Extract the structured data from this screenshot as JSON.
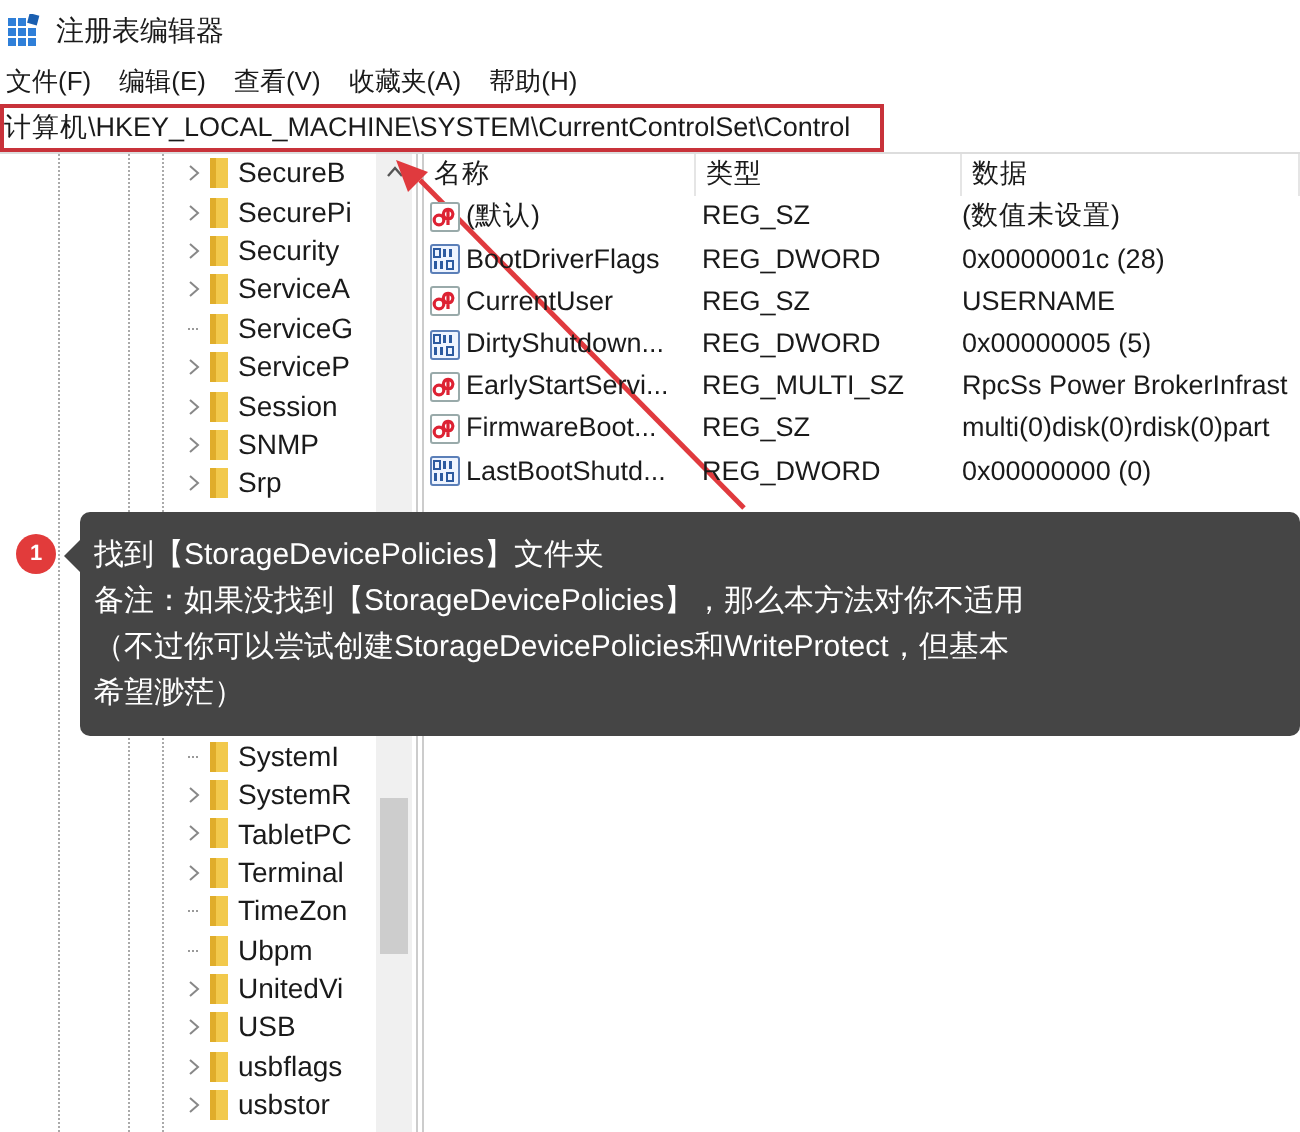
{
  "window": {
    "title": "注册表编辑器"
  },
  "menu": [
    "文件(F)",
    "编辑(E)",
    "查看(V)",
    "收藏夹(A)",
    "帮助(H)"
  ],
  "address": "计算机\\HKEY_LOCAL_MACHINE\\SYSTEM\\CurrentControlSet\\Control",
  "tree": {
    "items_above": [
      {
        "name": "SecureB",
        "has_children": true
      },
      {
        "name": "SecurePi",
        "has_children": true
      },
      {
        "name": "Security",
        "has_children": true
      },
      {
        "name": "ServiceA",
        "has_children": true
      },
      {
        "name": "ServiceG",
        "has_children": false
      },
      {
        "name": "ServiceP",
        "has_children": true
      },
      {
        "name": "Session",
        "has_children": true
      },
      {
        "name": "SNMP",
        "has_children": true
      },
      {
        "name": "Srp",
        "has_children": true
      }
    ],
    "items_below": [
      {
        "name": "SystemI",
        "has_children": false
      },
      {
        "name": "SystemR",
        "has_children": true
      },
      {
        "name": "TabletPC",
        "has_children": true
      },
      {
        "name": "Terminal",
        "has_children": true
      },
      {
        "name": "TimeZon",
        "has_children": false
      },
      {
        "name": "Ubpm",
        "has_children": false
      },
      {
        "name": "UnitedVi",
        "has_children": true
      },
      {
        "name": "USB",
        "has_children": true
      },
      {
        "name": "usbflags",
        "has_children": true
      },
      {
        "name": "usbstor",
        "has_children": true
      }
    ]
  },
  "values": {
    "columns": [
      "名称",
      "类型",
      "数据"
    ],
    "rows": [
      {
        "kind": "string",
        "name": "(默认)",
        "type": "REG_SZ",
        "data": "(数值未设置)"
      },
      {
        "kind": "binary",
        "name": "BootDriverFlags",
        "type": "REG_DWORD",
        "data": "0x0000001c (28)"
      },
      {
        "kind": "string",
        "name": "CurrentUser",
        "type": "REG_SZ",
        "data": "USERNAME"
      },
      {
        "kind": "binary",
        "name": "DirtyShutdown...",
        "type": "REG_DWORD",
        "data": "0x00000005 (5)"
      },
      {
        "kind": "string",
        "name": "EarlyStartServi...",
        "type": "REG_MULTI_SZ",
        "data": "RpcSs Power BrokerInfrast"
      },
      {
        "kind": "string",
        "name": "FirmwareBoot...",
        "type": "REG_SZ",
        "data": "multi(0)disk(0)rdisk(0)part"
      },
      {
        "kind": "binary",
        "name": "LastBootShutd...",
        "type": "REG_DWORD",
        "data": "0x00000000 (0)"
      }
    ]
  },
  "callout": {
    "badge": "1",
    "lines": [
      "找到【StorageDevicePolicies】文件夹",
      "备注：如果没找到【StorageDevicePolicies】，那么本方法对你不适用",
      "（不过你可以尝试创建StorageDevicePolicies和WriteProtect，但基本",
      "希望渺茫）"
    ]
  }
}
